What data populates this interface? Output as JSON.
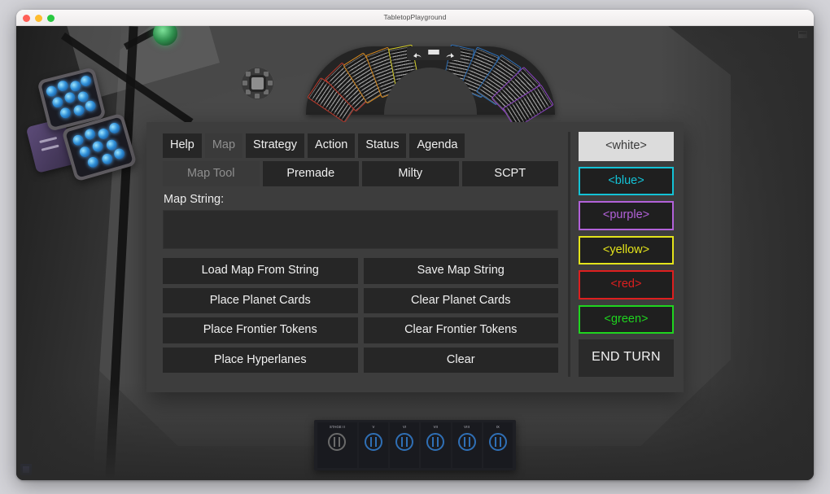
{
  "window": {
    "title": "TabletopPlayground",
    "traffic_lights": [
      "close",
      "minimize",
      "zoom"
    ]
  },
  "viewport": {
    "toolbar": {
      "undo_label": "undo-arrow",
      "menu_label": "hamburger-menu",
      "redo_label": "redo-arrow"
    },
    "corner_top_right_icon": "screenshot-icon",
    "corner_bottom_left_icon": "blue-square-indicator",
    "card_fan_colors": [
      "#c0392b",
      "#d98b20",
      "#d6cf2a",
      "#2f6fb5",
      "#8e44c6"
    ]
  },
  "panel": {
    "tabs_row1": [
      {
        "label": "Help",
        "disabled": false
      },
      {
        "label": "Map",
        "disabled": true
      },
      {
        "label": "Strategy",
        "disabled": false
      },
      {
        "label": "Action",
        "disabled": false
      },
      {
        "label": "Status",
        "disabled": false
      },
      {
        "label": "Agenda",
        "disabled": false
      }
    ],
    "tabs_row2": [
      {
        "label": "Map Tool",
        "disabled": true
      },
      {
        "label": "Premade",
        "disabled": false
      },
      {
        "label": "Milty",
        "disabled": false
      },
      {
        "label": "SCPT",
        "disabled": false
      }
    ],
    "map_string": {
      "label": "Map String:",
      "value": "",
      "placeholder": ""
    },
    "actions": [
      "Load Map From String",
      "Save Map String",
      "Place Planet Cards",
      "Clear Planet Cards",
      "Place Frontier Tokens",
      "Clear Frontier Tokens",
      "Place Hyperlanes",
      "Clear"
    ],
    "players": [
      {
        "label": "<white>",
        "color": "#dcdcdc",
        "active": true
      },
      {
        "label": "<blue>",
        "color": "#13c2d6",
        "active": false
      },
      {
        "label": "<purple>",
        "color": "#b261d9",
        "active": false
      },
      {
        "label": "<yellow>",
        "color": "#e3e31b",
        "active": false
      },
      {
        "label": "<red>",
        "color": "#dd1f1f",
        "active": false
      },
      {
        "label": "<green>",
        "color": "#1fd41f",
        "active": false
      }
    ],
    "end_turn_label": "END TURN"
  },
  "objective_strip": {
    "slots": [
      {
        "label": "STAGE II",
        "style": "grey"
      },
      {
        "label": "V",
        "style": "blue"
      },
      {
        "label": "VI",
        "style": "blue"
      },
      {
        "label": "VII",
        "style": "blue"
      },
      {
        "label": "VIII",
        "style": "blue"
      },
      {
        "label": "IX",
        "style": "blue"
      }
    ]
  }
}
